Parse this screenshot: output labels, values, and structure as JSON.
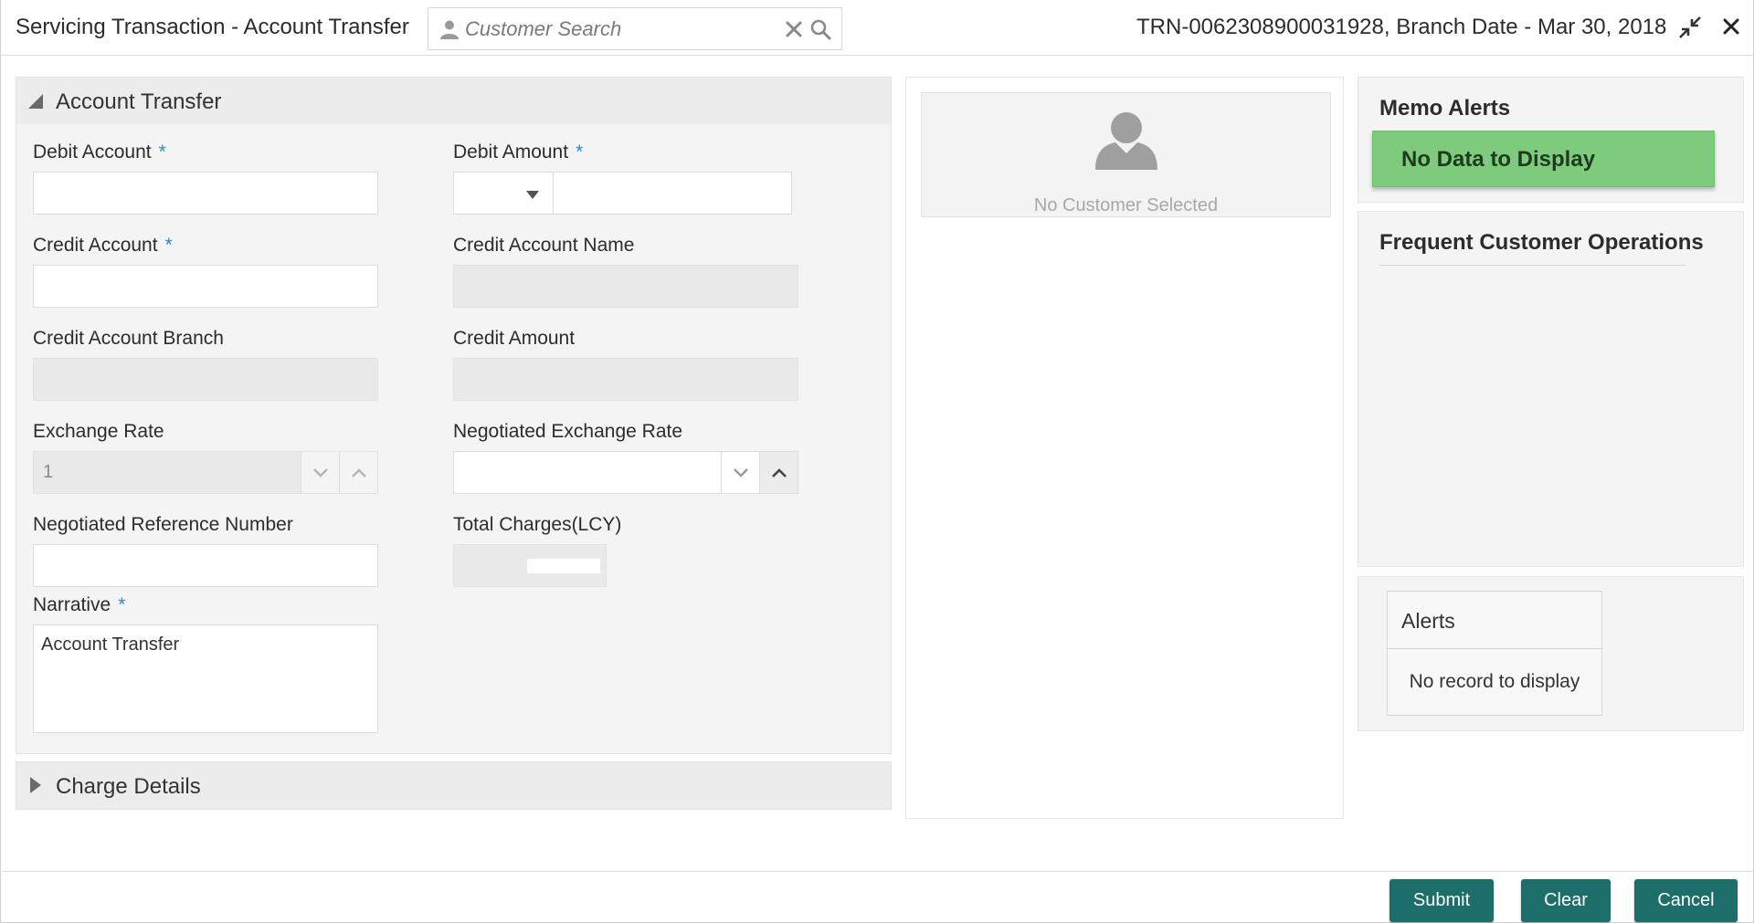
{
  "header": {
    "title": "Servicing Transaction - Account Transfer",
    "search_placeholder": "Customer Search",
    "transaction_info": "TRN-0062308900031928, Branch Date - Mar 30, 2018"
  },
  "account_transfer": {
    "section_title": "Account Transfer",
    "fields": {
      "debit_account": {
        "label": "Debit Account",
        "value": ""
      },
      "debit_amount": {
        "label": "Debit Amount",
        "currency": "",
        "value": ""
      },
      "credit_account": {
        "label": "Credit Account",
        "value": ""
      },
      "credit_account_name": {
        "label": "Credit Account Name",
        "value": ""
      },
      "credit_account_branch": {
        "label": "Credit Account Branch",
        "value": ""
      },
      "credit_amount": {
        "label": "Credit Amount",
        "value": ""
      },
      "exchange_rate": {
        "label": "Exchange Rate",
        "value": "1"
      },
      "negotiated_exchange_rate": {
        "label": "Negotiated Exchange Rate",
        "value": ""
      },
      "negotiated_reference_number": {
        "label": "Negotiated Reference Number",
        "value": ""
      },
      "total_charges": {
        "label": "Total Charges(LCY)",
        "value": ""
      },
      "narrative": {
        "label": "Narrative",
        "value": "Account Transfer"
      }
    },
    "required_marker": "*"
  },
  "charge_details": {
    "title": "Charge Details"
  },
  "customer_card": {
    "message": "No Customer Selected"
  },
  "memo_alerts": {
    "title": "Memo Alerts",
    "message": "No Data to Display"
  },
  "frequent_operations": {
    "title": "Frequent Customer Operations"
  },
  "alerts": {
    "title": "Alerts",
    "message": "No record to display"
  },
  "footer": {
    "submit": "Submit",
    "clear": "Clear",
    "cancel": "Cancel"
  },
  "colors": {
    "primary_button": "#1d6e6b",
    "success": "#7ecb7e",
    "required": "#2d87c8"
  }
}
